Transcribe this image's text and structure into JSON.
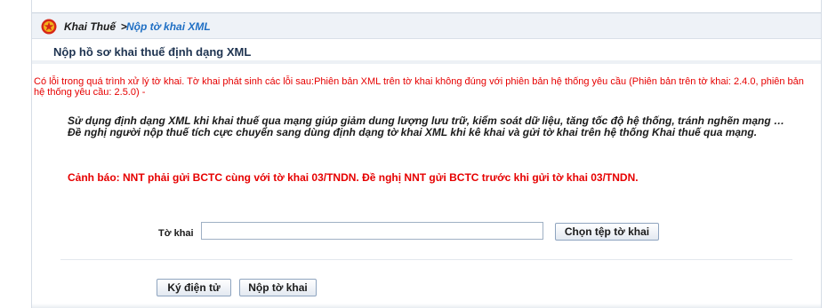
{
  "breadcrumb": {
    "home": "Khai Thuế",
    "separator": ">",
    "current": "Nộp tờ khai XML",
    "emblem_icon": "national-emblem-icon"
  },
  "page": {
    "title": "Nộp hồ sơ khai thuế định dạng XML"
  },
  "messages": {
    "error": "Có lỗi trong quá trình xử lý tờ khai. Tờ khai phát sinh các lỗi sau:Phiên bản XML trên tờ khai không đúng với phiên bản hệ thống yêu cầu (Phiên bản trên tờ khai: 2.4.0, phiên bản hệ thống yêu cầu: 2.5.0) -",
    "info": "Sử dụng định dạng XML khi khai thuế qua mạng giúp giảm dung lượng lưu trữ, kiểm soát dữ liệu, tăng tốc độ hệ thống, tránh nghẽn mạng … Đề nghị người nộp thuế tích cực chuyển sang dùng định dạng tờ khai XML khi kê khai và gửi tờ khai trên hệ thống Khai thuế qua mạng.",
    "warning": "Cảnh báo: NNT phải gửi BCTC cùng với tờ khai 03/TNDN. Đề nghị NNT gửi BCTC trước khi gửi tờ khai 03/TNDN."
  },
  "form": {
    "file_label": "Tờ khai",
    "file_value": "",
    "choose_button": "Chọn tệp tờ khai",
    "sign_button": "Ký điện tử",
    "submit_button": "Nộp tờ khai"
  },
  "colors": {
    "error": "#e60000",
    "link": "#1f6fc4",
    "title": "#1e3350"
  }
}
